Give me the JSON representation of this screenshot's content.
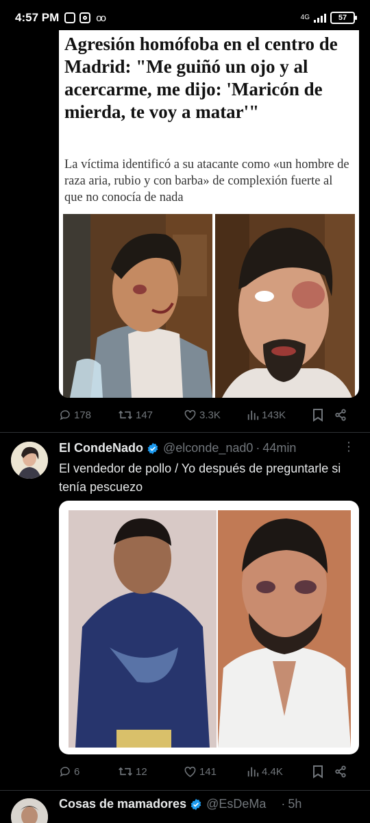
{
  "status": {
    "time": "4:57 PM",
    "network": "4G",
    "battery": "57"
  },
  "tweet1": {
    "article": {
      "headline": "Agresión homófoba en el centro de Madrid: \"Me guiñó un ojo y al acercarme, me dijo: 'Maricón de mierda, te voy a matar'\"",
      "subheadline": "La víctima identificó a su atacante como «un hombre de raza aria, rubio y con barba» de complexión fuerte al que no conocía de nada"
    },
    "stats": {
      "replies": "178",
      "retweets": "147",
      "likes": "3.3K",
      "views": "143K"
    }
  },
  "tweet2": {
    "author": "El CondeNado",
    "handle": "@elconde_nad0",
    "time": "44min",
    "text": "El vendedor de pollo / Yo después de preguntarle si tenía pescuezo",
    "stats": {
      "replies": "6",
      "retweets": "12",
      "likes": "141",
      "views": "4.4K"
    }
  },
  "tweet3": {
    "author": "Cosas de mamadores",
    "handle": "@EsDeMa",
    "time": "5h"
  },
  "colors": {
    "background": "#000000",
    "text": "#e7e9ea",
    "muted": "#71767b",
    "verified": "#1d9bf0",
    "divider": "#2f3336"
  }
}
